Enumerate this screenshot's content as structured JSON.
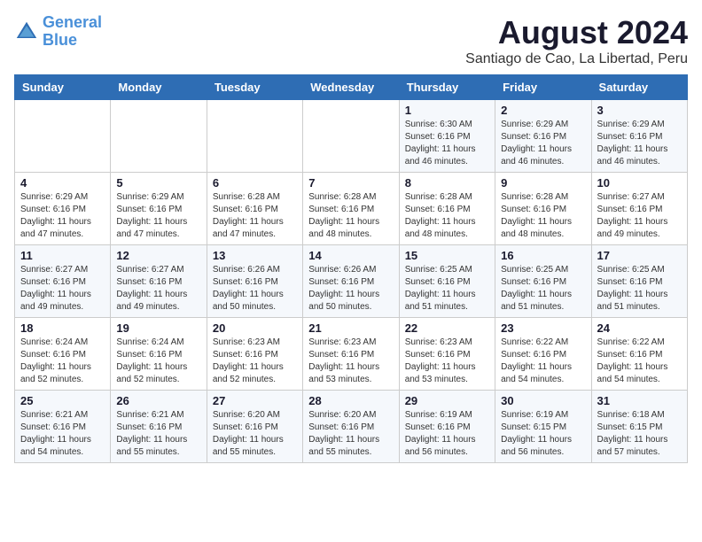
{
  "logo": {
    "line1": "General",
    "line2": "Blue"
  },
  "title": "August 2024",
  "subtitle": "Santiago de Cao, La Libertad, Peru",
  "weekdays": [
    "Sunday",
    "Monday",
    "Tuesday",
    "Wednesday",
    "Thursday",
    "Friday",
    "Saturday"
  ],
  "weeks": [
    [
      {
        "day": "",
        "info": ""
      },
      {
        "day": "",
        "info": ""
      },
      {
        "day": "",
        "info": ""
      },
      {
        "day": "",
        "info": ""
      },
      {
        "day": "1",
        "info": "Sunrise: 6:30 AM\nSunset: 6:16 PM\nDaylight: 11 hours\nand 46 minutes."
      },
      {
        "day": "2",
        "info": "Sunrise: 6:29 AM\nSunset: 6:16 PM\nDaylight: 11 hours\nand 46 minutes."
      },
      {
        "day": "3",
        "info": "Sunrise: 6:29 AM\nSunset: 6:16 PM\nDaylight: 11 hours\nand 46 minutes."
      }
    ],
    [
      {
        "day": "4",
        "info": "Sunrise: 6:29 AM\nSunset: 6:16 PM\nDaylight: 11 hours\nand 47 minutes."
      },
      {
        "day": "5",
        "info": "Sunrise: 6:29 AM\nSunset: 6:16 PM\nDaylight: 11 hours\nand 47 minutes."
      },
      {
        "day": "6",
        "info": "Sunrise: 6:28 AM\nSunset: 6:16 PM\nDaylight: 11 hours\nand 47 minutes."
      },
      {
        "day": "7",
        "info": "Sunrise: 6:28 AM\nSunset: 6:16 PM\nDaylight: 11 hours\nand 48 minutes."
      },
      {
        "day": "8",
        "info": "Sunrise: 6:28 AM\nSunset: 6:16 PM\nDaylight: 11 hours\nand 48 minutes."
      },
      {
        "day": "9",
        "info": "Sunrise: 6:28 AM\nSunset: 6:16 PM\nDaylight: 11 hours\nand 48 minutes."
      },
      {
        "day": "10",
        "info": "Sunrise: 6:27 AM\nSunset: 6:16 PM\nDaylight: 11 hours\nand 49 minutes."
      }
    ],
    [
      {
        "day": "11",
        "info": "Sunrise: 6:27 AM\nSunset: 6:16 PM\nDaylight: 11 hours\nand 49 minutes."
      },
      {
        "day": "12",
        "info": "Sunrise: 6:27 AM\nSunset: 6:16 PM\nDaylight: 11 hours\nand 49 minutes."
      },
      {
        "day": "13",
        "info": "Sunrise: 6:26 AM\nSunset: 6:16 PM\nDaylight: 11 hours\nand 50 minutes."
      },
      {
        "day": "14",
        "info": "Sunrise: 6:26 AM\nSunset: 6:16 PM\nDaylight: 11 hours\nand 50 minutes."
      },
      {
        "day": "15",
        "info": "Sunrise: 6:25 AM\nSunset: 6:16 PM\nDaylight: 11 hours\nand 51 minutes."
      },
      {
        "day": "16",
        "info": "Sunrise: 6:25 AM\nSunset: 6:16 PM\nDaylight: 11 hours\nand 51 minutes."
      },
      {
        "day": "17",
        "info": "Sunrise: 6:25 AM\nSunset: 6:16 PM\nDaylight: 11 hours\nand 51 minutes."
      }
    ],
    [
      {
        "day": "18",
        "info": "Sunrise: 6:24 AM\nSunset: 6:16 PM\nDaylight: 11 hours\nand 52 minutes."
      },
      {
        "day": "19",
        "info": "Sunrise: 6:24 AM\nSunset: 6:16 PM\nDaylight: 11 hours\nand 52 minutes."
      },
      {
        "day": "20",
        "info": "Sunrise: 6:23 AM\nSunset: 6:16 PM\nDaylight: 11 hours\nand 52 minutes."
      },
      {
        "day": "21",
        "info": "Sunrise: 6:23 AM\nSunset: 6:16 PM\nDaylight: 11 hours\nand 53 minutes."
      },
      {
        "day": "22",
        "info": "Sunrise: 6:23 AM\nSunset: 6:16 PM\nDaylight: 11 hours\nand 53 minutes."
      },
      {
        "day": "23",
        "info": "Sunrise: 6:22 AM\nSunset: 6:16 PM\nDaylight: 11 hours\nand 54 minutes."
      },
      {
        "day": "24",
        "info": "Sunrise: 6:22 AM\nSunset: 6:16 PM\nDaylight: 11 hours\nand 54 minutes."
      }
    ],
    [
      {
        "day": "25",
        "info": "Sunrise: 6:21 AM\nSunset: 6:16 PM\nDaylight: 11 hours\nand 54 minutes."
      },
      {
        "day": "26",
        "info": "Sunrise: 6:21 AM\nSunset: 6:16 PM\nDaylight: 11 hours\nand 55 minutes."
      },
      {
        "day": "27",
        "info": "Sunrise: 6:20 AM\nSunset: 6:16 PM\nDaylight: 11 hours\nand 55 minutes."
      },
      {
        "day": "28",
        "info": "Sunrise: 6:20 AM\nSunset: 6:16 PM\nDaylight: 11 hours\nand 55 minutes."
      },
      {
        "day": "29",
        "info": "Sunrise: 6:19 AM\nSunset: 6:16 PM\nDaylight: 11 hours\nand 56 minutes."
      },
      {
        "day": "30",
        "info": "Sunrise: 6:19 AM\nSunset: 6:15 PM\nDaylight: 11 hours\nand 56 minutes."
      },
      {
        "day": "31",
        "info": "Sunrise: 6:18 AM\nSunset: 6:15 PM\nDaylight: 11 hours\nand 57 minutes."
      }
    ]
  ],
  "colors": {
    "header_bg": "#2e6db4",
    "header_text": "#ffffff",
    "odd_row": "#f5f8fc",
    "even_row": "#ffffff"
  }
}
